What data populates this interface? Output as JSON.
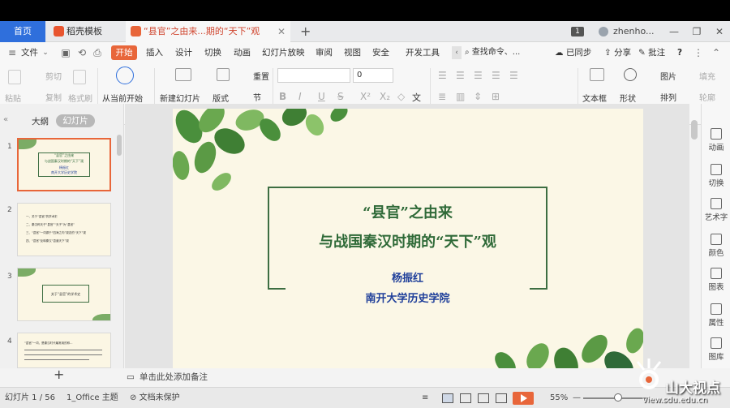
{
  "tabs": {
    "home": "首页",
    "doc1": "稻壳模板",
    "doc2": "“县官”之由来...期的“天下”观"
  },
  "user": {
    "badge": "1",
    "name": "zhenho..."
  },
  "menu": {
    "file": "文件",
    "start": "开始",
    "items": [
      "插入",
      "设计",
      "切换",
      "动画",
      "幻灯片放映",
      "审阅",
      "视图",
      "安全",
      "开发工具"
    ],
    "search": "查找命令、...",
    "sync": "已同步",
    "share": "分享",
    "comment": "批注",
    "help": "?"
  },
  "ribbon": {
    "paste": "粘贴",
    "cut": "剪切",
    "copy": "复制",
    "format_painter": "格式刷",
    "from_current": "从当前开始",
    "new_slide": "新建幻灯片",
    "layout": "版式",
    "reset": "重置",
    "section": "节",
    "font_size": "0",
    "bold": "B",
    "italic": "I",
    "underline": "U",
    "strike": "S",
    "text_a": "文",
    "textbox": "文本框",
    "shape": "形状",
    "picture": "图片",
    "arrange": "排列",
    "fill": "填充",
    "outline": "轮廓"
  },
  "left_panel": {
    "outline_tab": "大纲",
    "slides_tab": "幻灯片",
    "thumbs": [
      {
        "num": "1",
        "line1": "“县官”之由来",
        "line2": "与战国秦汉时期的“天下”观",
        "line3": "杨振红",
        "line4": "南开大学历史学院"
      },
      {
        "num": "2",
        "lines": [
          "一、关于“县官”的学术史",
          "二、秦汉称天子“县官”“天子”为“县官”",
          "三、“县官”一词源于“四海之内”观念的“天下”观",
          "四、“县官”反映秦汉“县道天下”观"
        ]
      },
      {
        "num": "3",
        "line1": "关于“县官”的学术史"
      },
      {
        "num": "4",
        "line1": "“县官”一词，是秦汉时代最常用的称..."
      }
    ]
  },
  "slide": {
    "title_line1": "“县官”之由来",
    "title_line2": "与战国秦汉时期的“天下”观",
    "author": "杨振红",
    "institution": "南开大学历史学院"
  },
  "right_panel": {
    "items": [
      "动画",
      "切换",
      "艺术字",
      "颜色",
      "图表",
      "属性",
      "图库"
    ]
  },
  "notes_placeholder": "单击此处添加备注",
  "status": {
    "slide_counter": "幻灯片 1 / 56",
    "theme": "1_Office 主题",
    "protect": "文档未保护",
    "zoom": "55%"
  },
  "watermark": {
    "brand": "山大视点",
    "url": "view.sdu.edu.cn"
  },
  "colors": {
    "accent": "#e8663a",
    "home_tab": "#2f6fdc",
    "slide_title": "#2f6a38",
    "slide_author": "#1f3f9a",
    "leaf": "#4a8f3c"
  }
}
